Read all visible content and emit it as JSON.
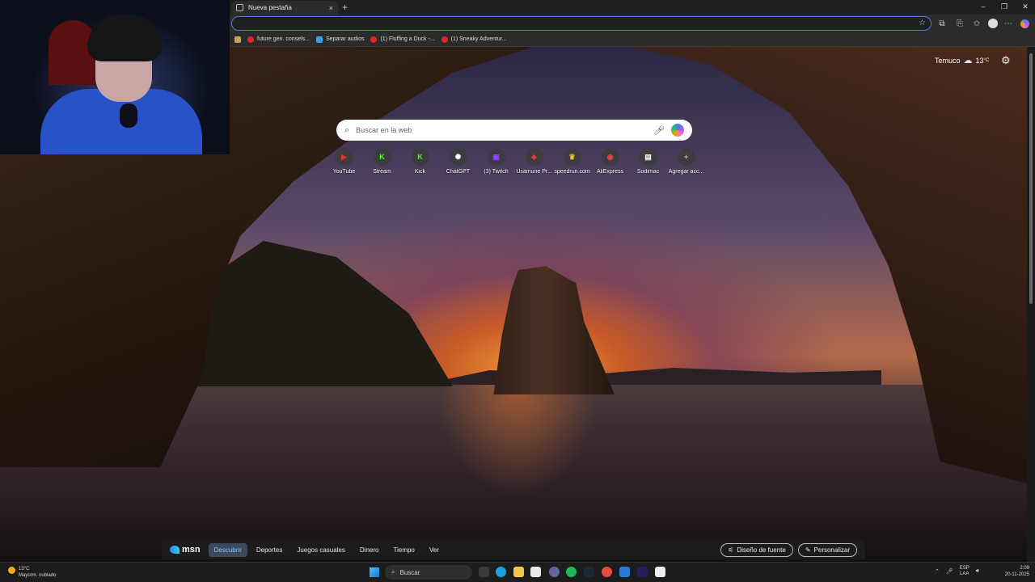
{
  "browser": {
    "tab_title": "Nueva pestaña",
    "tab_close": "×",
    "new_tab": "+",
    "window_controls": [
      "–",
      "❐",
      "✕"
    ],
    "address_value": "",
    "bookmarks": [
      {
        "label": "future gen. consels..."
      },
      {
        "label": "Separar audios"
      },
      {
        "label": "(1) Fluffing a Duck -..."
      },
      {
        "label": "(1) Sneaky Adventur..."
      }
    ]
  },
  "weather": {
    "city": "Temuco",
    "temp": "13",
    "unit": "°C"
  },
  "search": {
    "placeholder": "Buscar en la web"
  },
  "quick_links": [
    {
      "label": "YouTube",
      "glyph": "▶",
      "color": "#ff2a2a"
    },
    {
      "label": "Stream",
      "glyph": "K",
      "color": "#53fc18"
    },
    {
      "label": "Kick",
      "glyph": "K",
      "color": "#53fc18"
    },
    {
      "label": "ChatGPT",
      "glyph": "✺",
      "color": "#ffffff"
    },
    {
      "label": "(3) Twitch",
      "glyph": "▣",
      "color": "#9146ff"
    },
    {
      "label": "Usamune Pr...",
      "glyph": "◆",
      "color": "#e53935"
    },
    {
      "label": "speedrun.com",
      "glyph": "🏆",
      "color": "#f5c518"
    },
    {
      "label": "AliExpress",
      "glyph": "◉",
      "color": "#ff3b3b"
    },
    {
      "label": "Sodimac",
      "glyph": "▤",
      "color": "#ffffff"
    },
    {
      "label": "Agregar acc...",
      "glyph": "+",
      "color": "#bbbbbb"
    }
  ],
  "msn": {
    "logo": "msn",
    "tabs": [
      "Descubrir",
      "Deportes",
      "Juegos casuales",
      "Dinero",
      "Tiempo",
      "Ver"
    ],
    "active_tab": "Descubrir",
    "font_button": "Diseño de fuente",
    "personalize_button": "Personalizar"
  },
  "taskbar": {
    "weather_temp": "13°C",
    "weather_desc": "Mayorm. nublado",
    "search_label": "Buscar",
    "lang_top": "ESP",
    "lang_bottom": "LAA",
    "time": "2:09",
    "date": "20-11-2025"
  },
  "colors": {
    "accent": "#4a7ad6",
    "msn_active": "#8fc1ff"
  }
}
